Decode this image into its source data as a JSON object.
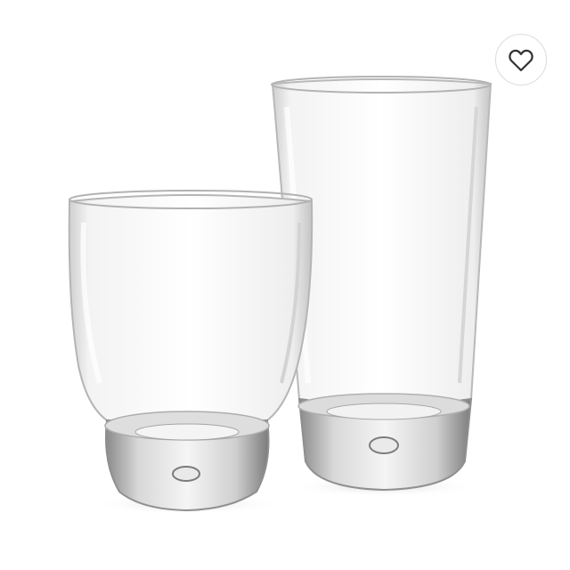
{
  "product": {
    "image_icon": "drinking-glasses-photo",
    "favorite": {
      "icon": "heart-outline-icon",
      "active": false,
      "color": "#333333"
    }
  }
}
